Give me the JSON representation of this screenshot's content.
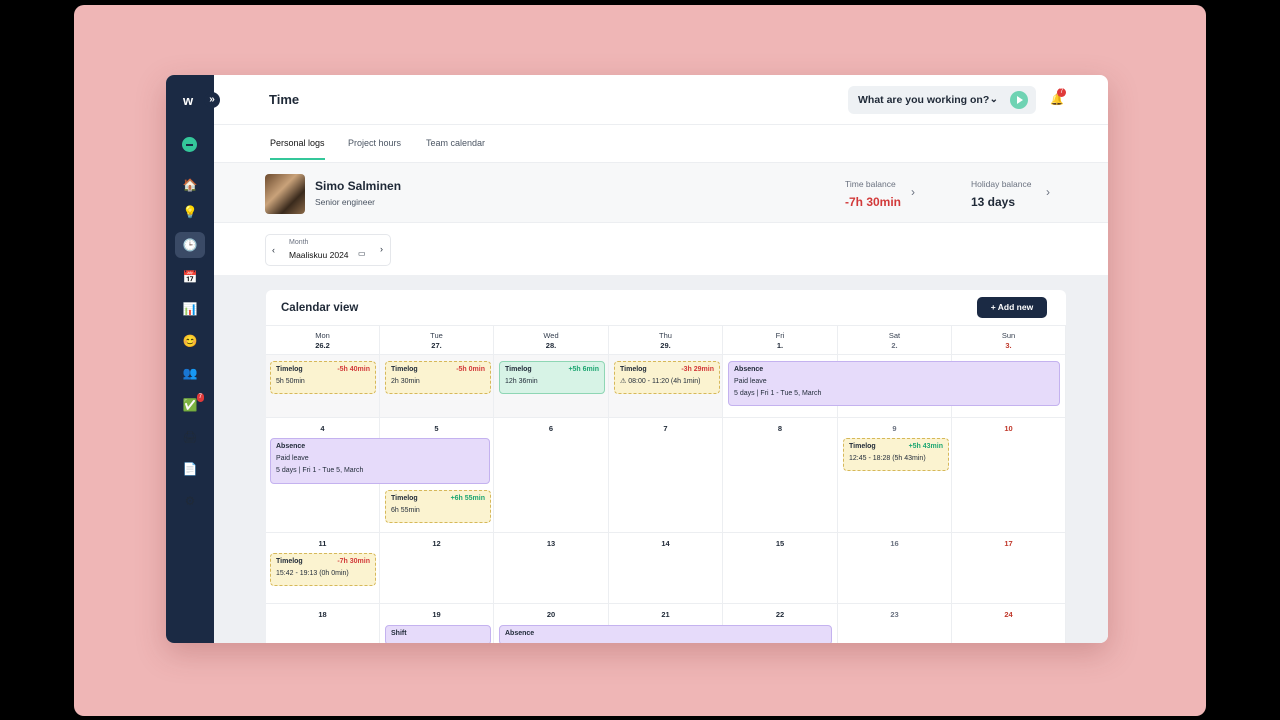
{
  "app": {
    "logo": "w",
    "expand": "»",
    "title": "Time"
  },
  "topbar": {
    "working_placeholder": "What are you working on?",
    "bell_badge": "7"
  },
  "sidebar": {
    "icons": [
      {
        "name": "home-icon",
        "glyph": "🏠"
      },
      {
        "name": "lightbulb-icon",
        "glyph": "💡"
      },
      {
        "name": "clock-icon",
        "glyph": "🕒",
        "active": true
      },
      {
        "name": "calendar-icon",
        "glyph": "📅"
      },
      {
        "name": "chart-icon",
        "glyph": "📊"
      },
      {
        "name": "smiley-icon",
        "glyph": "😊"
      },
      {
        "name": "team-icon",
        "glyph": "👥"
      },
      {
        "name": "checkmark-icon",
        "glyph": "✅",
        "badge": "7"
      },
      {
        "name": "printer-icon",
        "glyph": "🖨"
      },
      {
        "name": "document-icon",
        "glyph": "📄"
      },
      {
        "name": "gear-icon",
        "glyph": "⚙"
      }
    ]
  },
  "tabs": [
    "Personal logs",
    "Project hours",
    "Team calendar"
  ],
  "profile": {
    "name": "Simo Salminen",
    "role": "Senior engineer",
    "time_balance_label": "Time balance",
    "time_balance": "-7h 30min",
    "holiday_balance_label": "Holiday balance",
    "holiday_balance": "13 days"
  },
  "month": {
    "label": "Month",
    "value": "Maaliskuu 2024"
  },
  "calendar": {
    "title": "Calendar view",
    "add_label": "+ Add new",
    "days": [
      [
        "Mon",
        "26.2"
      ],
      [
        "Tue",
        "27."
      ],
      [
        "Wed",
        "28."
      ],
      [
        "Thu",
        "29."
      ],
      [
        "Fri",
        "1."
      ],
      [
        "Sat",
        "2."
      ],
      [
        "Sun",
        "3."
      ]
    ],
    "weeks": [
      [
        "",
        "",
        "",
        "",
        "",
        "",
        ""
      ],
      [
        "4",
        "5",
        "6",
        "7",
        "8",
        "9",
        "10"
      ],
      [
        "11",
        "12",
        "13",
        "14",
        "15",
        "16",
        "17"
      ],
      [
        "18",
        "19",
        "20",
        "21",
        "22",
        "23",
        "24"
      ]
    ],
    "events": [
      {
        "kind": "tl",
        "title": "Timelog",
        "delta": "-5h 40min",
        "delta_class": "neg",
        "line": "5h 50min"
      },
      {
        "kind": "tl",
        "title": "Timelog",
        "delta": "-5h 0min",
        "delta_class": "neg",
        "line": "2h 30min"
      },
      {
        "kind": "tl pos",
        "title": "Timelog",
        "delta": "+5h 6min",
        "delta_class": "pos-c",
        "line": "12h 36min"
      },
      {
        "kind": "tl",
        "title": "Timelog",
        "delta": "-3h 29min",
        "delta_class": "neg",
        "line": "⚠ 08:00 - 11:20 (4h 1min)"
      },
      {
        "kind": "ab",
        "title": "Absence",
        "line": "Paid leave",
        "line2": "5 days | Fri 1 - Tue 5, March"
      },
      {
        "kind": "ab",
        "title": "Absence",
        "line": "Paid leave",
        "line2": "5 days | Fri 1 - Tue 5, March"
      },
      {
        "kind": "tl",
        "title": "Timelog",
        "delta": "+6h 55min",
        "delta_class": "pos-c",
        "line": "6h 55min"
      },
      {
        "kind": "tl",
        "title": "Timelog",
        "delta": "+5h 43min",
        "delta_class": "pos-c",
        "line": "12:45 - 18:28 (5h 43min)"
      },
      {
        "kind": "tl",
        "title": "Timelog",
        "delta": "-7h 30min",
        "delta_class": "neg",
        "line": "15:42 - 19:13 (0h 0min)"
      },
      {
        "kind": "ab",
        "title": "Shift"
      },
      {
        "kind": "ab",
        "title": "Absence"
      }
    ]
  }
}
